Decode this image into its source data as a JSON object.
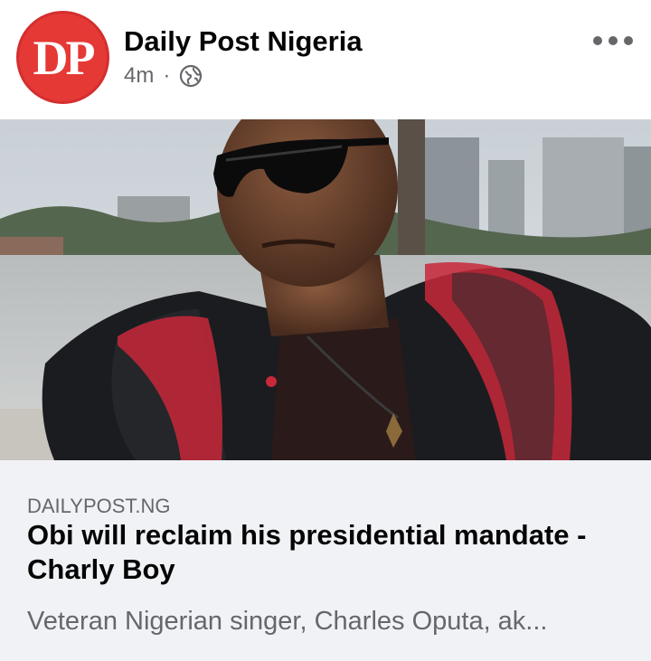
{
  "post": {
    "page_name": "Daily Post Nigeria",
    "avatar_text": "DP",
    "time": "4m",
    "separator": "·",
    "audience_icon": "globe-icon",
    "more_icon": "more-options-icon"
  },
  "link_preview": {
    "domain": "DAILYPOST.NG",
    "headline": "Obi will reclaim his presidential mandate - Charly Boy",
    "description": "Veteran Nigerian singer, Charles Oputa, ak..."
  },
  "colors": {
    "brand_red": "#e53935",
    "card_bg": "#f0f2f5",
    "secondary_text": "#65676b"
  }
}
